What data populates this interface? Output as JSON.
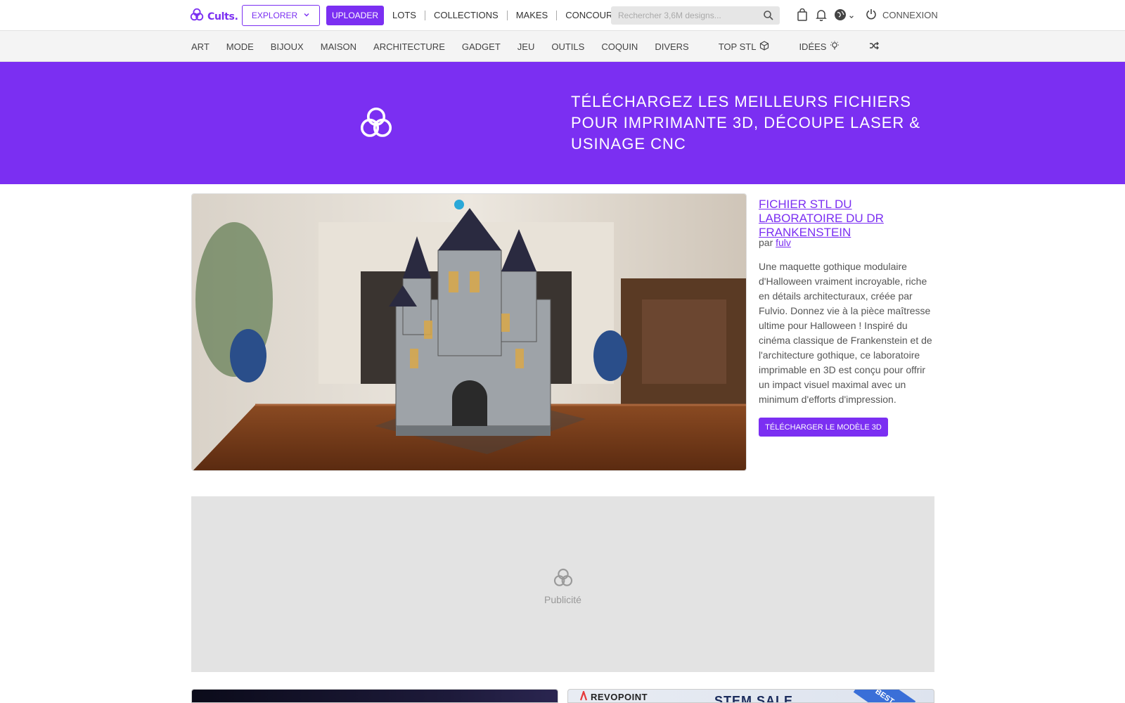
{
  "header": {
    "logo_text": "Cults.",
    "explorer_label": "EXPLORER",
    "upload_label": "UPLOADER",
    "links": [
      "LOTS",
      "COLLECTIONS",
      "MAKES",
      "CONCOURS"
    ],
    "search_placeholder": "Rechercher 3,6M designs...",
    "login_label": "CONNEXION"
  },
  "categories": {
    "items": [
      "ART",
      "MODE",
      "BIJOUX",
      "MAISON",
      "ARCHITECTURE",
      "GADGET",
      "JEU",
      "OUTILS",
      "COQUIN",
      "DIVERS"
    ],
    "top_stl": "TOP STL",
    "ideas": "IDÉES"
  },
  "hero": {
    "title": "TÉLÉCHARGEZ LES MEILLEURS FICHIERS POUR IMPRIMANTE 3D, DÉCOUPE LASER & USINAGE CNC"
  },
  "feature": {
    "title": "FICHIER STL DU LABORATOIRE DU DR FRANKENSTEIN",
    "by_prefix": "par",
    "author": "fulv",
    "description": "Une maquette gothique modulaire d'Halloween vraiment incroyable, riche en détails architecturaux, créée par Fulvio. Donnez vie à la pièce maîtresse ultime pour Halloween ! Inspiré du cinéma classique de Frankenstein et de l'architecture gothique, ce laboratoire imprimable en 3D est conçu pour offrir un impact visuel maximal avec un minimum d'efforts d'impression.",
    "download_label": "TÉLÉCHARGER LE MODÈLE 3D"
  },
  "ad": {
    "label": "Publicité"
  },
  "banners": {
    "right_brand": "REVOPOINT",
    "right_sale": "STEM SALE",
    "right_corner": "BEST"
  },
  "colors": {
    "accent": "#7b2ff2"
  }
}
